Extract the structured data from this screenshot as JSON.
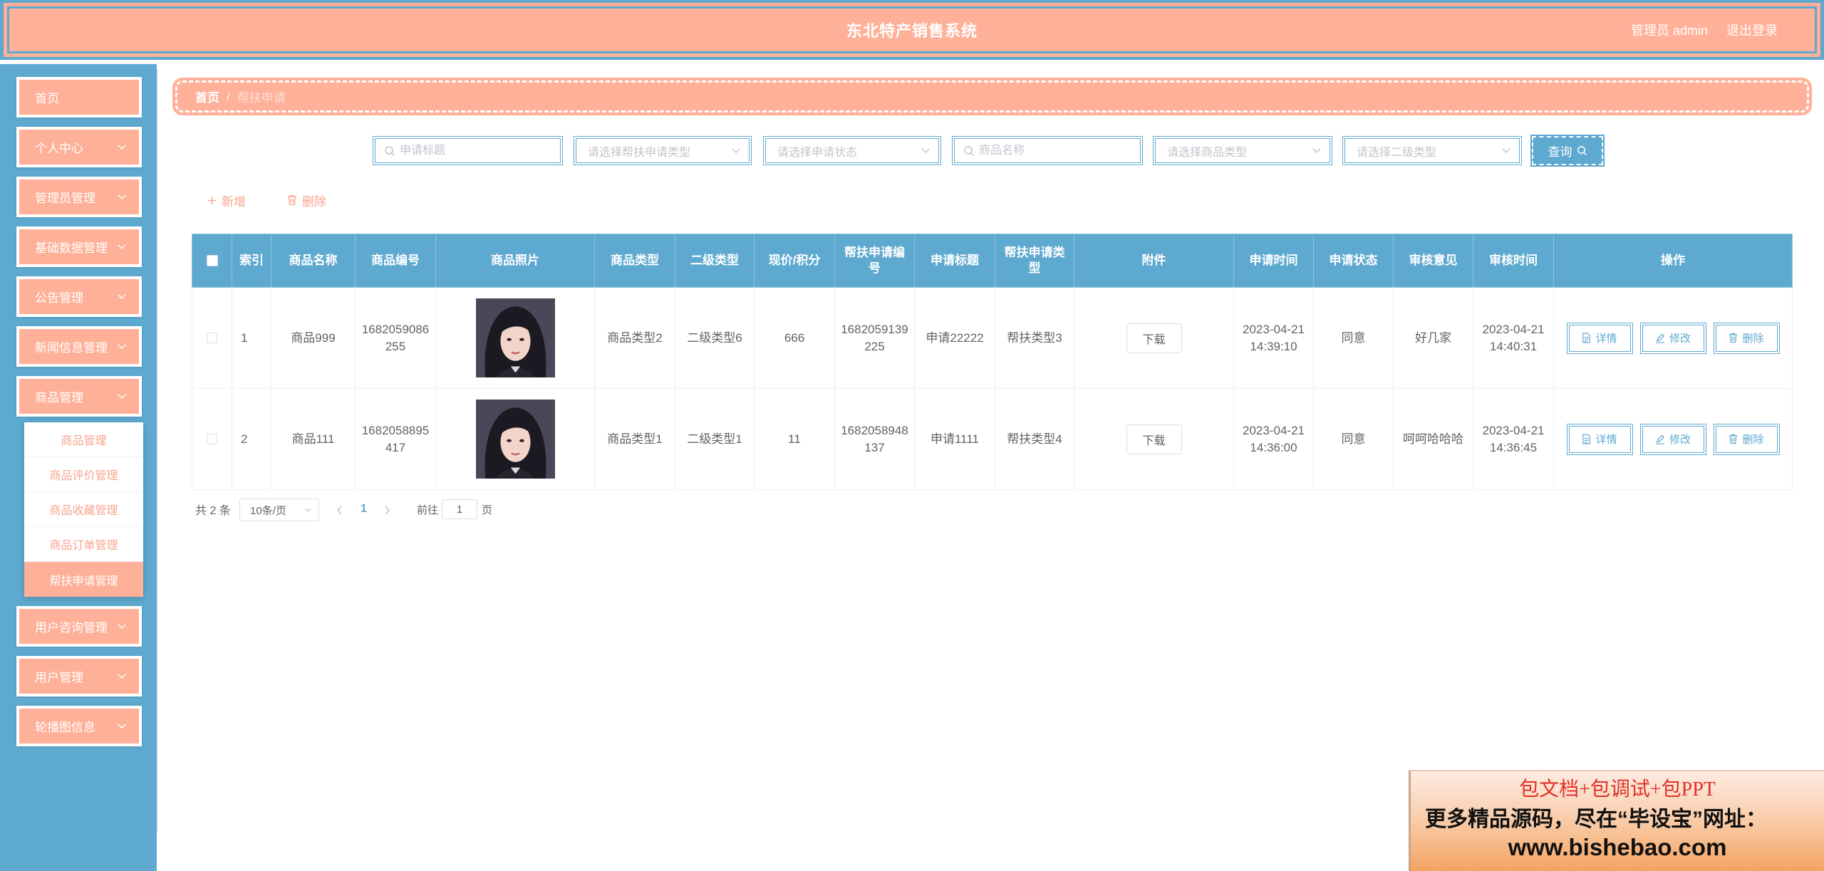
{
  "header": {
    "title": "东北特产销售系统",
    "user": "管理员 admin",
    "logout": "退出登录"
  },
  "sidebar": {
    "items": [
      "首页",
      "个人中心",
      "管理员管理",
      "基础数据管理",
      "公告管理",
      "新闻信息管理",
      "商品管理",
      "用户咨询管理",
      "用户管理",
      "轮播图信息"
    ],
    "submenu": [
      "商品管理",
      "商品评价管理",
      "商品收藏管理",
      "商品订单管理",
      "帮扶申请管理"
    ]
  },
  "breadcrumb": {
    "home": "首页",
    "separator": "/",
    "current": "帮扶申请"
  },
  "search": {
    "apply_title_placeholder": "申请标题",
    "help_type_placeholder": "请选择帮扶申请类型",
    "status_placeholder": "请选择申请状态",
    "product_name_placeholder": "商品名称",
    "product_type_placeholder": "请选择商品类型",
    "sub_type_placeholder": "请选择二级类型",
    "button": "查询"
  },
  "actions": {
    "add": "新增",
    "delete": "删除"
  },
  "table": {
    "columns": [
      "索引",
      "商品名称",
      "商品编号",
      "商品照片",
      "商品类型",
      "二级类型",
      "现价/积分",
      "帮扶申请编号",
      "申请标题",
      "帮扶申请类型",
      "附件",
      "申请时间",
      "申请状态",
      "审核意见",
      "审核时间",
      "操作"
    ],
    "rows": [
      {
        "index": "1",
        "product_name": "商品999",
        "product_code": "1682059086255",
        "product_type": "商品类型2",
        "sub_type": "二级类型6",
        "price_points": "666",
        "apply_code": "1682059139225",
        "apply_title": "申请22222",
        "apply_type": "帮扶类型3",
        "attachment": "下载",
        "apply_time": "2023-04-21 14:39:10",
        "status": "同意",
        "review_opinion": "好几家",
        "review_time": "2023-04-21 14:40:31"
      },
      {
        "index": "2",
        "product_name": "商品111",
        "product_code": "1682058895417",
        "product_type": "商品类型1",
        "sub_type": "二级类型1",
        "price_points": "11",
        "apply_code": "1682058948137",
        "apply_title": "申请1111",
        "apply_type": "帮扶类型4",
        "attachment": "下载",
        "apply_time": "2023-04-21 14:36:00",
        "status": "同意",
        "review_opinion": "呵呵哈哈哈",
        "review_time": "2023-04-21 14:36:45"
      }
    ],
    "row_actions": {
      "detail": "详情",
      "edit": "修改",
      "delete": "删除"
    }
  },
  "pagination": {
    "total": "共 2 条",
    "page_size": "10条/页",
    "current_page": "1",
    "goto_label": "前往",
    "goto_value": "1",
    "page_suffix": "页"
  },
  "watermark": {
    "line1": "包文档+包调试+包PPT",
    "line2": "更多精品源码，尽在“毕设宝”网址：",
    "line3": "www.bishebao.com"
  },
  "colors": {
    "salmon": "#ffb098",
    "blue": "#5ea9cf",
    "text": "#606266",
    "placeholder": "#c0c4cc",
    "watermark_red": "#e0302a"
  },
  "icons": [
    "search-icon",
    "chevron-down-icon",
    "plus-icon",
    "trash-icon",
    "document-icon",
    "edit-icon",
    "chevron-left-icon",
    "chevron-right-icon"
  ]
}
